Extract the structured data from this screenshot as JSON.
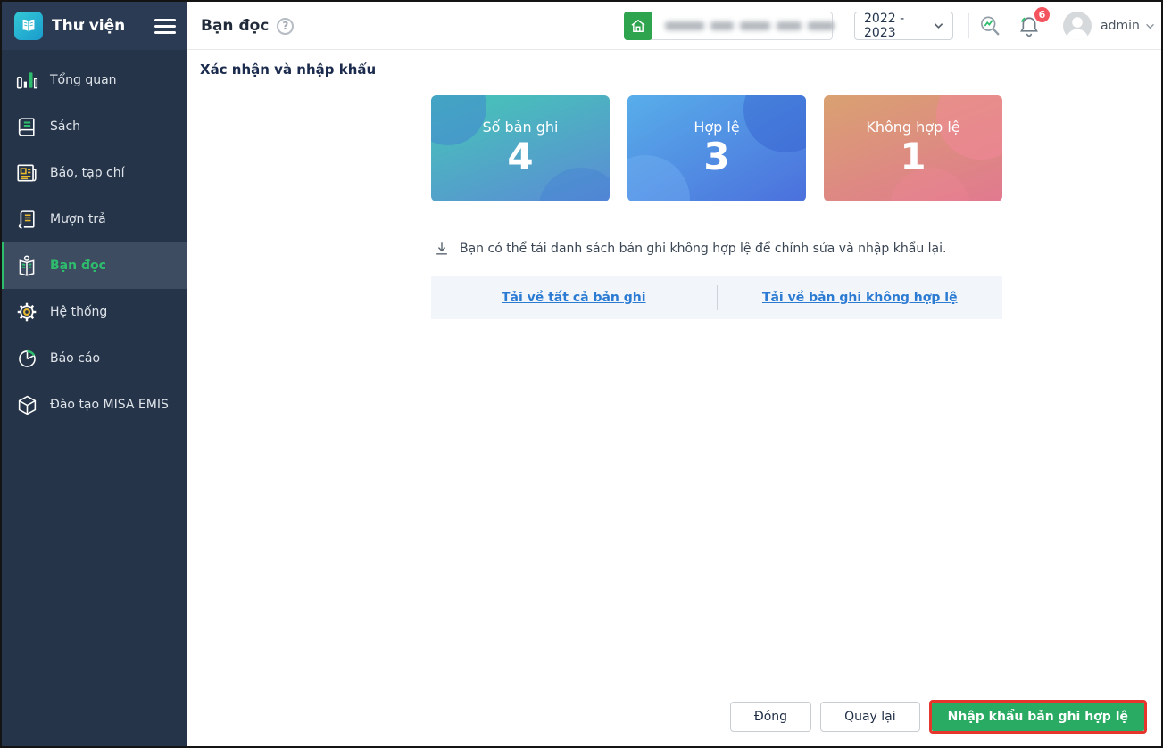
{
  "app": {
    "title": "Thư viện"
  },
  "sidebar": {
    "items": [
      {
        "label": "Tổng quan",
        "icon": "bar-chart-icon"
      },
      {
        "label": "Sách",
        "icon": "book-icon"
      },
      {
        "label": "Báo, tạp chí",
        "icon": "newspaper-icon"
      },
      {
        "label": "Mượn trả",
        "icon": "borrow-return-icon"
      },
      {
        "label": "Bạn đọc",
        "icon": "reader-icon",
        "active": true
      },
      {
        "label": "Hệ thống",
        "icon": "gear-icon"
      },
      {
        "label": "Báo cáo",
        "icon": "pie-chart-icon"
      },
      {
        "label": "Đào tạo MISA EMIS",
        "icon": "cube-icon"
      }
    ],
    "active_color": "#2ebd6d",
    "background_color": "#253449"
  },
  "header": {
    "page_title": "Bạn đọc",
    "school_year": "2022 - 2023",
    "notification_badge": "6",
    "user_name": "admin"
  },
  "content": {
    "section_title": "Xác nhận và nhập khẩu",
    "stats": [
      {
        "label": "Số bản ghi",
        "value": "4",
        "gradient": [
          "#45c7b5",
          "#5b8bd7"
        ]
      },
      {
        "label": "Hợp lệ",
        "value": "3",
        "gradient": [
          "#58aeea",
          "#4b70dc"
        ]
      },
      {
        "label": "Không hợp lệ",
        "value": "1",
        "gradient": [
          "#d9a171",
          "#e1798f"
        ]
      }
    ],
    "download_hint": "Bạn có thể tải danh sách bản ghi không hợp lệ để chỉnh sửa và nhập khẩu lại.",
    "download_links": [
      {
        "label": "Tải về tất cả bản ghi"
      },
      {
        "label": "Tải về bản ghi không hợp lệ"
      }
    ],
    "link_color": "#2b7bd3"
  },
  "footer": {
    "close_label": "Đóng",
    "back_label": "Quay lại",
    "import_label": "Nhập khẩu bản ghi hợp lệ",
    "import_button_color": "#2aab63",
    "annotation_color": "#e5352c"
  }
}
